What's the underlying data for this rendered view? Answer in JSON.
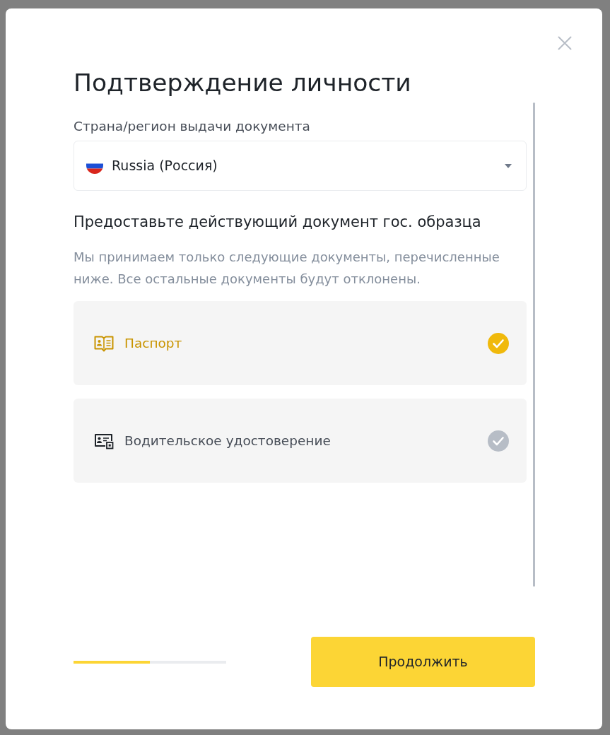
{
  "dialog": {
    "title": "Подтверждение личности"
  },
  "country_field": {
    "label": "Страна/регион выдачи документа",
    "value": "Russia (Россия)"
  },
  "documents_section": {
    "heading": "Предоставьте действующий документ гос. образца",
    "note": "Мы принимаем только следующие документы, перечисленные ниже. Все остальные документы будут отклонены."
  },
  "documents": [
    {
      "label": "Паспорт",
      "kind": "passport",
      "selected": true
    },
    {
      "label": "Водительское удостоверение",
      "kind": "driver_license",
      "selected": false
    }
  ],
  "progress": {
    "level": 0.5
  },
  "continue_button": {
    "label": "Продолжить"
  }
}
